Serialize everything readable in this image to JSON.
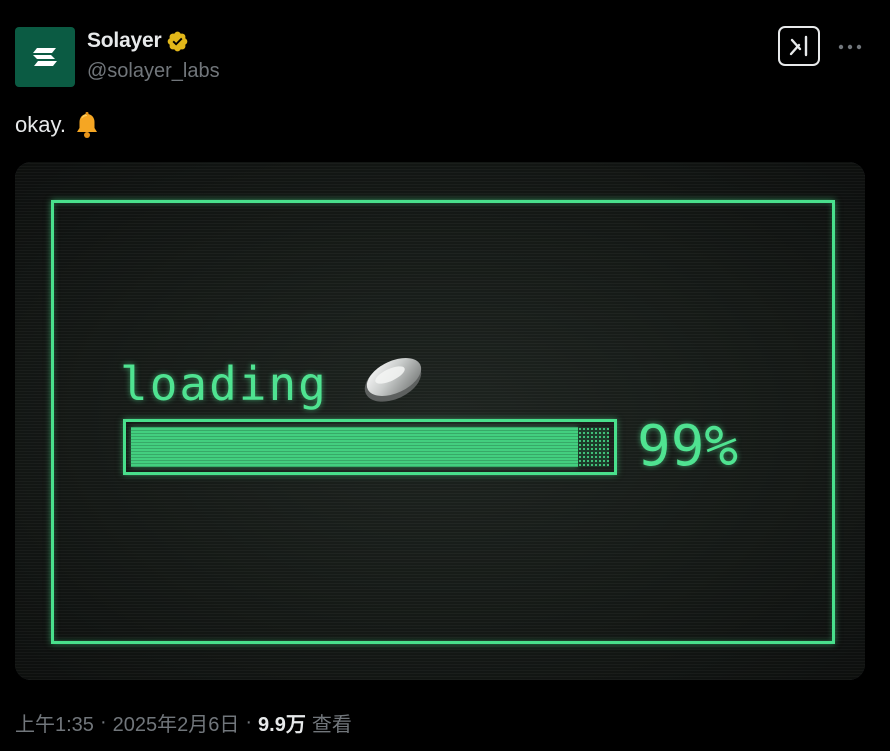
{
  "author": {
    "display_name": "Solayer",
    "handle": "@solayer_labs",
    "avatar_icon": "solayer-logo-icon",
    "verified_icon": "verified-gold-badge-icon",
    "avatar_color": "#0b5b43",
    "verified_color": "#e2b719"
  },
  "header_actions": {
    "grok_icon": "grok-icon",
    "more_icon": "more-dots-icon"
  },
  "tweet": {
    "text": "okay.",
    "emoji_icon": "bell-icon"
  },
  "media": {
    "loading_label": "loading",
    "coin_icon": "coin-icon",
    "progress_percent": 99,
    "percent_label": "99%",
    "accent_color": "#49e08c"
  },
  "meta": {
    "time": "上午1:35",
    "separator1": "·",
    "date": "2025年2月6日",
    "separator2": "·",
    "views_count": "9.9万",
    "views_label": "查看"
  }
}
